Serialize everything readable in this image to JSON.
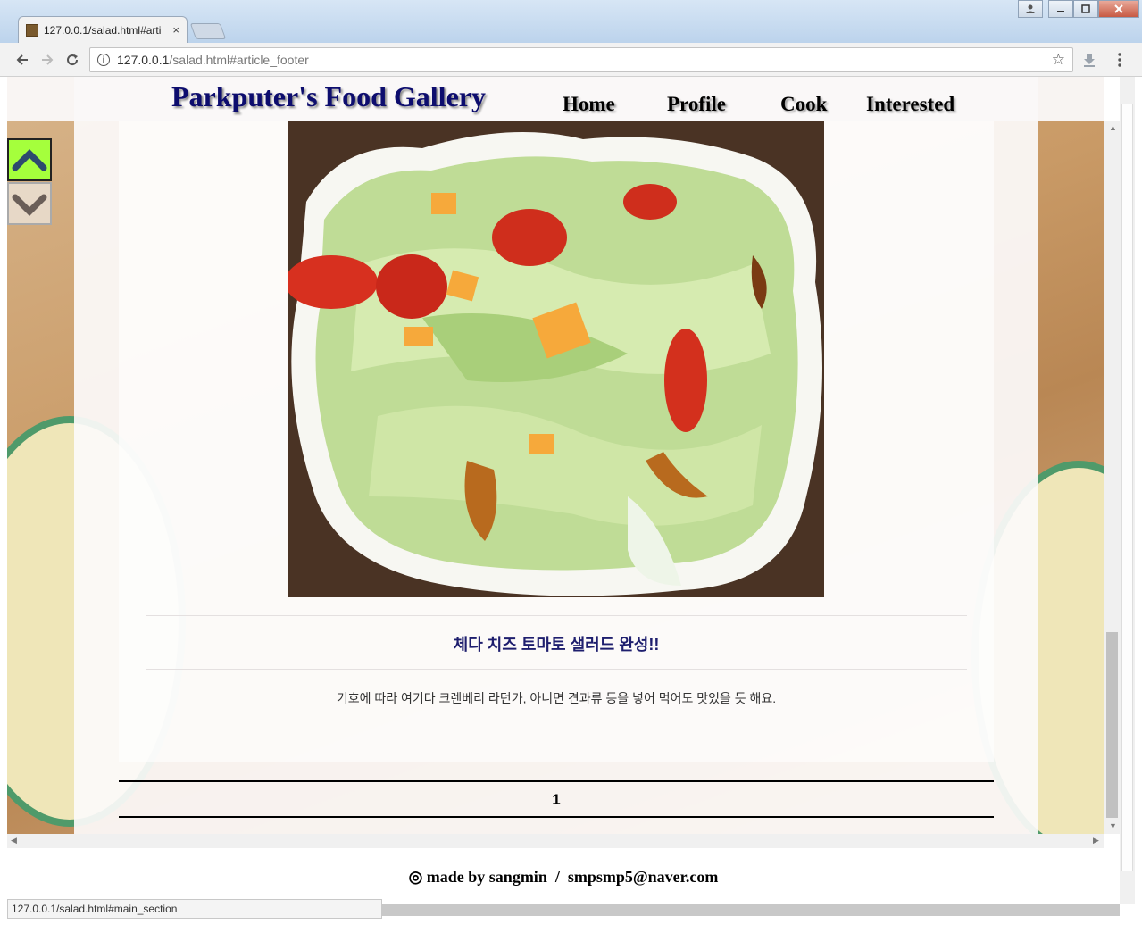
{
  "browser": {
    "tab_title": "127.0.0.1/salad.html#arti",
    "tab_close": "×",
    "url_host": "127.0.0.1",
    "url_path": "/salad.html#article_footer",
    "info_icon": "i",
    "star_icon": "☆",
    "status_text": "127.0.0.1/salad.html#main_section"
  },
  "site": {
    "logo": "Parkputer's Food Gallery",
    "nav": [
      {
        "label": "Home"
      },
      {
        "label": "Profile"
      },
      {
        "label": "Cook"
      },
      {
        "label": "Interested"
      }
    ]
  },
  "article": {
    "title": "체다 치즈 토마토 샐러드 완성!!",
    "text": "기호에 따라 여기다 크렌베리 라던가, 아니면 견과류 등을 넣어 먹어도 맛있을 듯 해요.",
    "page_number": "1"
  },
  "footer": {
    "icon": "◎",
    "text": "made by sangmin  /  smpsmp5@naver.com"
  },
  "colors": {
    "accent_button": "#a5ff3c",
    "logo_text": "#0d0d6e"
  }
}
